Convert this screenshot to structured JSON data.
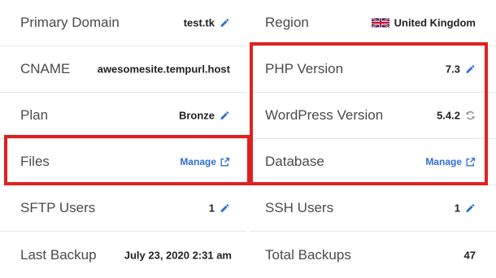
{
  "left": {
    "primary_domain": {
      "label": "Primary Domain",
      "value": "test.tk"
    },
    "cname": {
      "label": "CNAME",
      "value": "awesomesite.tempurl.host"
    },
    "plan": {
      "label": "Plan",
      "value": "Bronze"
    },
    "files": {
      "label": "Files",
      "link": "Manage"
    },
    "sftp_users": {
      "label": "SFTP Users",
      "value": "1"
    },
    "last_backup": {
      "label": "Last Backup",
      "value": "July 23, 2020 2:31 am"
    }
  },
  "right": {
    "region": {
      "label": "Region",
      "value": "United Kingdom",
      "flag": "uk-flag"
    },
    "php_version": {
      "label": "PHP Version",
      "value": "7.3"
    },
    "wordpress_version": {
      "label": "WordPress Version",
      "value": "5.4.2"
    },
    "database": {
      "label": "Database",
      "link": "Manage"
    },
    "ssh_users": {
      "label": "SSH Users",
      "value": "1"
    },
    "total_backups": {
      "label": "Total Backups",
      "value": "47"
    }
  },
  "colors": {
    "accent": "#2f6fd6",
    "highlight": "#e02020"
  },
  "icons": {
    "edit": "pencil-icon",
    "external": "external-link-icon",
    "refresh": "refresh-icon"
  }
}
